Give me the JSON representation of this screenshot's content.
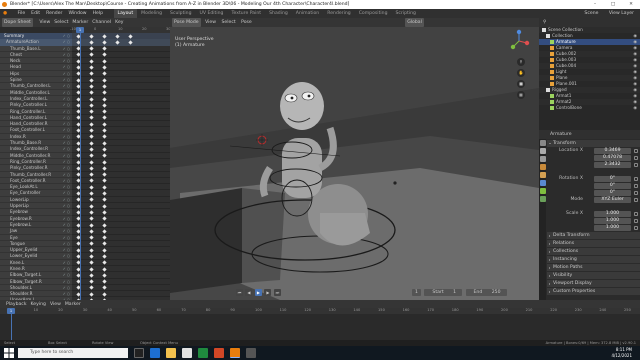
{
  "window": {
    "title": "Blender* [C:\\Users\\Alex The Man\\Desktop\\Course - Creating Animations from A-Z in Blender 3D\\06 - Modeling Our 4th Character\\Character4l.blend]"
  },
  "menubar": {
    "items": [
      "File",
      "Edit",
      "Render",
      "Window",
      "Help"
    ],
    "workspaces": [
      "Layout",
      "Modeling",
      "Sculpting",
      "UV Editing",
      "Texture Paint",
      "Shading",
      "Animation",
      "Rendering",
      "Compositing",
      "Scripting"
    ],
    "active_workspace": "Layout",
    "scene": "Scene",
    "view_layer": "View Layer"
  },
  "dopesheet": {
    "mode": "Dope Sheet",
    "header": [
      "View",
      "Select",
      "Marker",
      "Channel",
      "Key"
    ],
    "only_selected": "Only Show Selected",
    "summary": "Summary",
    "armature": "ArmatureAction",
    "bones": [
      "Thumb_Base.L",
      "Chest",
      "Neck",
      "Head",
      "Hips",
      "Spine",
      "Thumb_Controller.L",
      "Middle_Controller.L",
      "Index_Controller.L",
      "Pinky_Controller.L",
      "Ring_Controller.L",
      "Hand_Controller.L",
      "Hand_Controller.R",
      "Foot_Controller.L",
      "Index.R",
      "Thumb_Base.R",
      "Index_Controller.R",
      "Middle_Controller.R",
      "Ring_Controller.R",
      "Pinky_Controller.R",
      "Thumb_Controller.R",
      "Foot_Controller.R",
      "Eye_LookAt.L",
      "Eye_Controller",
      "LowerLip",
      "UpperLip",
      "Eyebrow",
      "Eyebrow.R",
      "Eyebrow.L",
      "Jaw",
      "Eye",
      "Tongue",
      "Upper_Eyelid",
      "Lower_Eyelid",
      "Knee.L",
      "Knee.R",
      "Elbow_Target.L",
      "Elbow_Target.R",
      "Shoulder.L",
      "Shoulder.R",
      "UpperArm.L"
    ],
    "ruler": [
      "-10",
      "0",
      "10",
      "20",
      "30"
    ],
    "current_frame": "1"
  },
  "viewport": {
    "header": [
      "Pose Mode",
      "View",
      "Select",
      "Pose"
    ],
    "view_name": "User Perspective",
    "object": "(1) Armature",
    "shading": "Global"
  },
  "outliner": {
    "title": "Scene Collection",
    "rows": [
      {
        "label": "Collection",
        "indent": 1,
        "color": "#dddddd"
      },
      {
        "label": "Armature",
        "indent": 2,
        "color": "#9bd35f",
        "sel": true
      },
      {
        "label": "Camera",
        "indent": 2,
        "color": "#e8a13a"
      },
      {
        "label": "Cube.002",
        "indent": 2,
        "color": "#e8a13a"
      },
      {
        "label": "Cube.003",
        "indent": 2,
        "color": "#e8a13a"
      },
      {
        "label": "Cube.004",
        "indent": 2,
        "color": "#e8a13a"
      },
      {
        "label": "Light",
        "indent": 2,
        "color": "#e8a13a"
      },
      {
        "label": "Plane",
        "indent": 2,
        "color": "#e8a13a"
      },
      {
        "label": "Plane.001",
        "indent": 2,
        "color": "#e8a13a"
      },
      {
        "label": "Rigged",
        "indent": 1,
        "color": "#dddddd"
      },
      {
        "label": "Armat1",
        "indent": 2,
        "color": "#9bd35f"
      },
      {
        "label": "Armat2",
        "indent": 2,
        "color": "#9bd35f"
      },
      {
        "label": "ControlBone",
        "indent": 2,
        "color": "#9bd35f"
      }
    ]
  },
  "properties": {
    "object": "Armature",
    "transform": "Transform",
    "location": {
      "label": "Location X",
      "x": "0.3469",
      "y": "0.47078",
      "z": "2.3432"
    },
    "rotation": {
      "label": "Rotation X",
      "x": "0°",
      "y": "0°",
      "z": "0°"
    },
    "mode_label": "Mode",
    "mode": "XYZ Euler",
    "scale": {
      "label": "Scale X",
      "x": "1.000",
      "y": "1.000",
      "z": "1.000"
    },
    "sections": [
      "Delta Transform",
      "Relations",
      "Collections",
      "Instancing",
      "Motion Paths",
      "Visibility",
      "Viewport Display",
      "Custom Properties"
    ]
  },
  "timeline": {
    "header": [
      "Playback",
      "Keying",
      "View",
      "Marker"
    ],
    "current": "1",
    "start_label": "Start",
    "start": "1",
    "end_label": "End",
    "end": "250",
    "ruler": [
      "0",
      "10",
      "20",
      "30",
      "40",
      "50",
      "60",
      "70",
      "80",
      "90",
      "100",
      "110",
      "120",
      "130",
      "140",
      "150",
      "160",
      "170",
      "180",
      "190",
      "200",
      "210",
      "220",
      "230",
      "240",
      "250"
    ]
  },
  "status": {
    "select": "Select",
    "box_select": "Box Select",
    "rotate": "Rotate View",
    "context": "Object Context Menu",
    "stats": "Armature | Bones:0/69 | Mem: 372.8 MiB | v2.90.1"
  },
  "taskbar": {
    "search": "Type here to search",
    "time": "8:11 PM",
    "date": "4/12/2021"
  },
  "keys": {
    "sum": [
      5,
      18,
      31,
      44,
      57
    ],
    "arm": [
      5,
      18,
      31,
      44,
      57
    ]
  }
}
